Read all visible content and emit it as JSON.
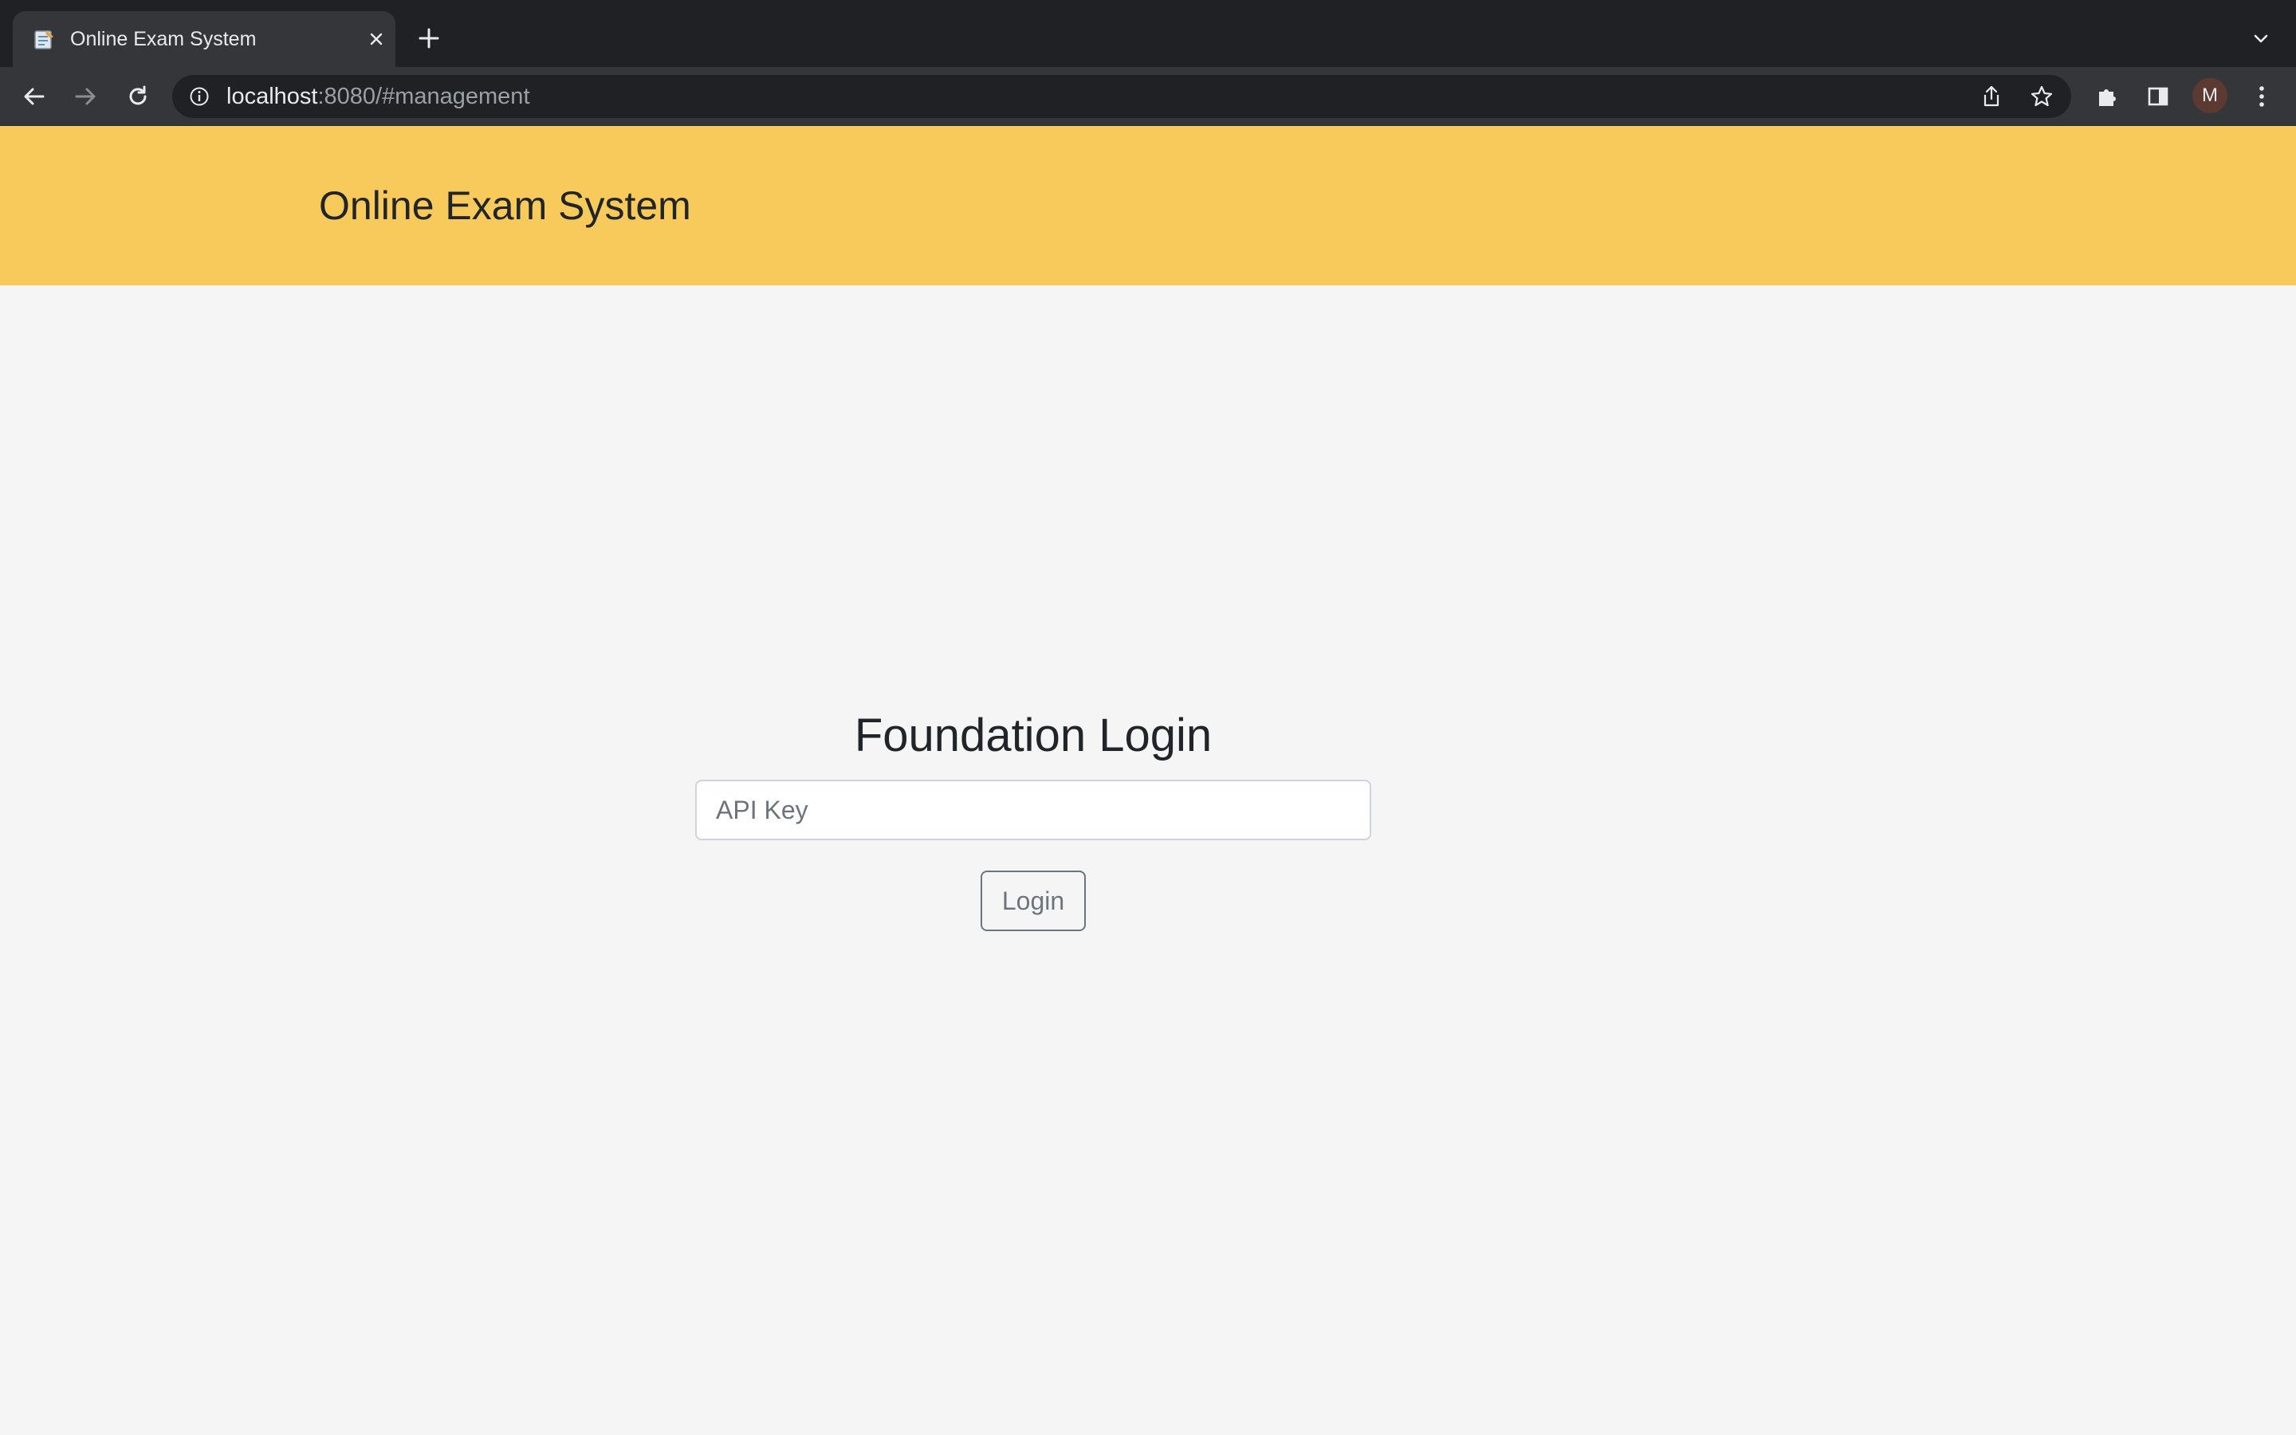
{
  "browser": {
    "tab": {
      "title": "Online Exam System",
      "favicon": "notepad-icon"
    },
    "address_bar": {
      "host": "localhost",
      "rest": ":8080/#management"
    },
    "profile_initial": "M",
    "icons": [
      "back-arrow-icon",
      "forward-arrow-icon",
      "reload-icon",
      "info-icon",
      "share-icon",
      "star-icon",
      "puzzle-icon",
      "side-panel-icon",
      "kebab-menu-icon",
      "chevron-down-icon",
      "plus-icon",
      "close-icon"
    ]
  },
  "header": {
    "brand": "Online Exam System",
    "background": "#f8ca5c"
  },
  "login": {
    "title": "Foundation Login",
    "api_key_placeholder": "API Key",
    "api_key_value": "",
    "submit_label": "Login"
  }
}
